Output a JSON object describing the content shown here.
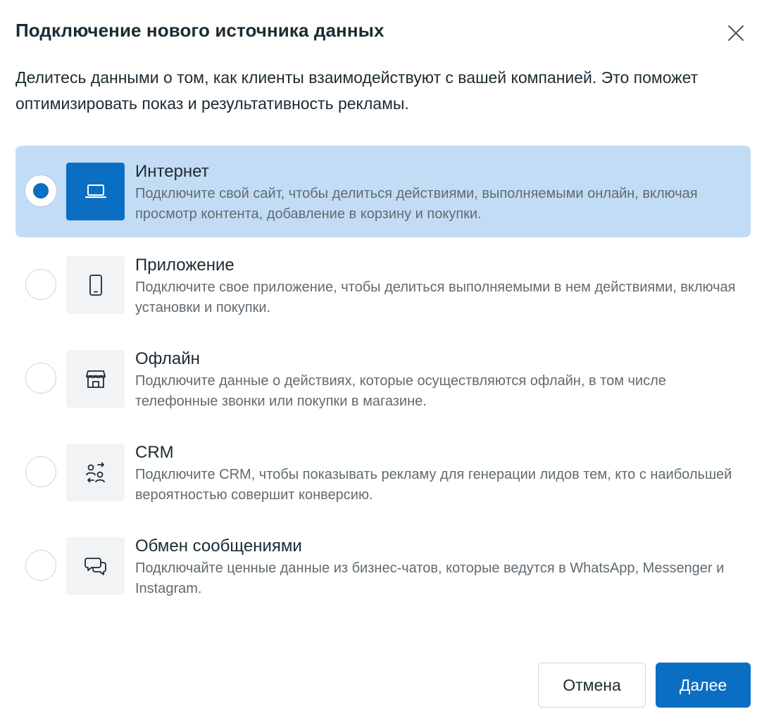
{
  "dialog": {
    "title": "Подключение нового источника данных",
    "description": "Делитесь данными о том, как клиенты взаимодействуют с вашей компанией. Это поможет оптимизировать показ и результативность рекламы.",
    "close_icon": "close-icon"
  },
  "options": [
    {
      "title": "Интернет",
      "description": "Подключите свой сайт, чтобы делиться действиями, выполняемыми онлайн, включая просмотр контента, добавление в корзину и покупки.",
      "icon": "laptop-icon",
      "selected": true
    },
    {
      "title": "Приложение",
      "description": "Подключите свое приложение, чтобы делиться выполняемыми в нем действиями, включая установки и покупки.",
      "icon": "phone-icon",
      "selected": false
    },
    {
      "title": "Офлайн",
      "description": "Подключите данные о действиях, которые осуществляются офлайн, в том числе телефонные звонки или покупки в магазине.",
      "icon": "store-icon",
      "selected": false
    },
    {
      "title": "CRM",
      "description": "Подключите CRM, чтобы показывать рекламу для генерации лидов тем, кто с наибольшей вероятностью совершит конверсию.",
      "icon": "people-exchange-icon",
      "selected": false
    },
    {
      "title": "Обмен сообщениями",
      "description": "Подключайте ценные данные из бизнес-чатов, которые ведутся в WhatsApp, Messenger и Instagram.",
      "icon": "chat-bubbles-icon",
      "selected": false
    }
  ],
  "footer": {
    "cancel_label": "Отмена",
    "next_label": "Далее"
  },
  "colors": {
    "accent": "#0a6fc2",
    "selected_background": "#c3dcf5",
    "icon_background": "#f1f3f5",
    "text_primary": "#1c2b33",
    "text_secondary": "#606b72"
  }
}
